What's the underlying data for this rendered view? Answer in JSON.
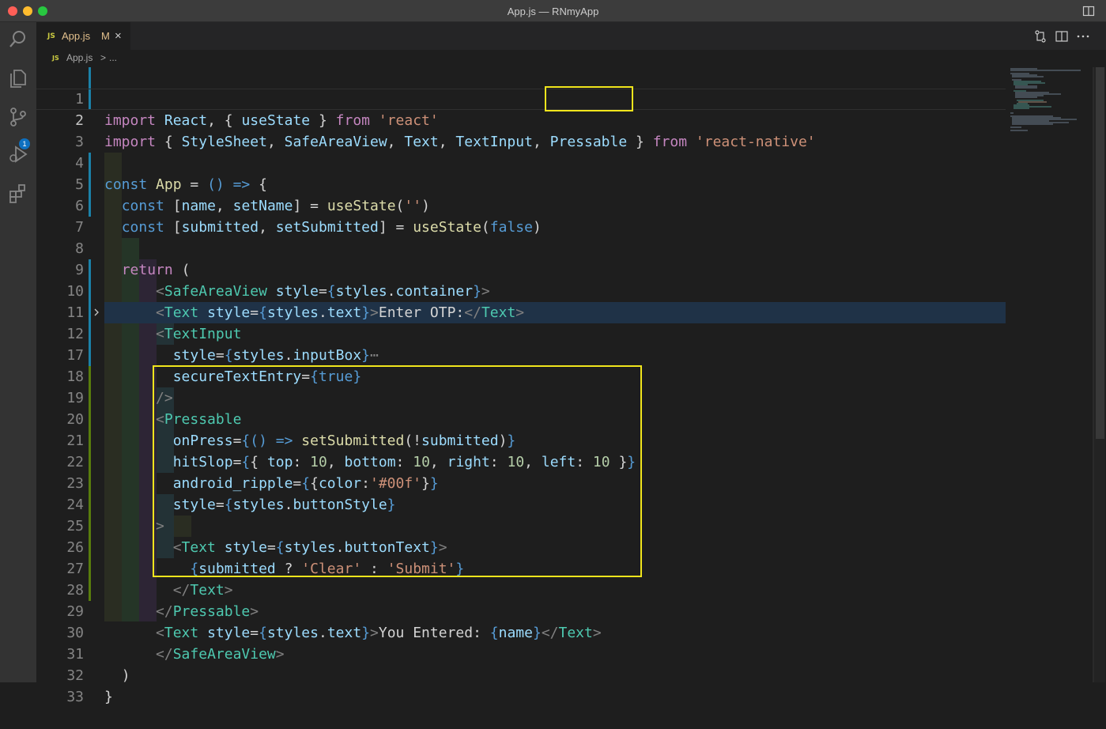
{
  "window": {
    "title": "App.js — RNmyApp"
  },
  "activity_bar": {
    "icons": [
      "files-search-icon",
      "explorer-icon",
      "source-control-icon",
      "run-debug-icon",
      "extensions-icon"
    ],
    "source_control_badge": "1"
  },
  "tabs": [
    {
      "badge": "JS",
      "label": "App.js",
      "modified": "M",
      "close": "×"
    }
  ],
  "breadcrumb": {
    "badge": "JS",
    "file": "App.js",
    "separator": ">",
    "more": "..."
  },
  "editor": {
    "lines": [
      {
        "n": "1"
      },
      {
        "n": "2"
      },
      {
        "n": "3"
      },
      {
        "n": "4"
      },
      {
        "n": "5"
      },
      {
        "n": "6"
      },
      {
        "n": "7"
      },
      {
        "n": "8"
      },
      {
        "n": "9"
      },
      {
        "n": "10"
      },
      {
        "n": "11"
      },
      {
        "n": "12"
      },
      {
        "n": "17"
      },
      {
        "n": "18"
      },
      {
        "n": "19"
      },
      {
        "n": "20"
      },
      {
        "n": "21"
      },
      {
        "n": "22"
      },
      {
        "n": "23"
      },
      {
        "n": "24"
      },
      {
        "n": "25"
      },
      {
        "n": "26"
      },
      {
        "n": "27"
      },
      {
        "n": "28"
      },
      {
        "n": "29"
      },
      {
        "n": "30"
      },
      {
        "n": "31"
      },
      {
        "n": "32"
      },
      {
        "n": "33"
      }
    ],
    "tokens": {
      "import": "import",
      "react": "React",
      "comma": ",",
      "lbrace": "{",
      "rbrace": "}",
      "useState": "useState",
      "from": "from",
      "react_str": "'react'",
      "StyleSheet": "StyleSheet",
      "SafeAreaView": "SafeAreaView",
      "Text": "Text",
      "TextInput": "TextInput",
      "Pressable": "Pressable",
      "rn_str": "'react-native'",
      "const": "const",
      "App": "App",
      "eq": "=",
      "arrow_fn": "() =>",
      "name": "name",
      "setName": "setName",
      "empty_str": "''",
      "submitted": "submitted",
      "setSubmitted": "setSubmitted",
      "false": "false",
      "true": "true",
      "return": "return",
      "lparen": "(",
      "rparen": ")",
      "style": "style",
      "styles": "styles",
      "container": "container",
      "text": "text",
      "inputBox": "inputBox",
      "secureTextEntry": "secureTextEntry",
      "onPress": "onPress",
      "hitSlop": "hitSlop",
      "top": "top",
      "bottom": "bottom",
      "right": "right",
      "left": "left",
      "ten": "10",
      "android_ripple": "android_ripple",
      "color": "color",
      "color_str": "'#00f'",
      "buttonStyle": "buttonStyle",
      "buttonText": "buttonText",
      "clear_str": "'Clear'",
      "submit_str": "'Submit'",
      "enter_otp": "Enter OTP:",
      "you_entered": "You Entered: ",
      "fold_ellipsis": "⋯"
    }
  }
}
